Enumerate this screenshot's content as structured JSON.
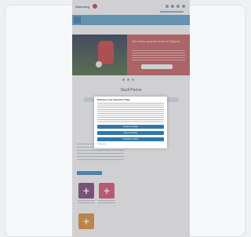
{
  "page": {
    "section_heading": "Studi Penns"
  },
  "header": {
    "logo_text": "Samsung"
  },
  "hero": {
    "title": "Sei sicuro quando crossi il Tapioca"
  },
  "cookie_modal": {
    "title": "Welcome to the University of Italy",
    "buttons": [
      {
        "label": "Accept all cookies"
      },
      {
        "label": "Deny all cookies"
      },
      {
        "label": "Customize cookies"
      }
    ],
    "footer_link": "Cookie policy"
  },
  "colors": {
    "brand_blue": "#2f78ad",
    "hero_red": "#c85a5a",
    "tile_purple": "#7a3f6e",
    "tile_pink": "#d94a6b",
    "tile_orange": "#e08a2a"
  },
  "icons": [
    "plus-icon",
    "plus-icon",
    "plus-icon",
    "menu-icon",
    "search-icon"
  ]
}
